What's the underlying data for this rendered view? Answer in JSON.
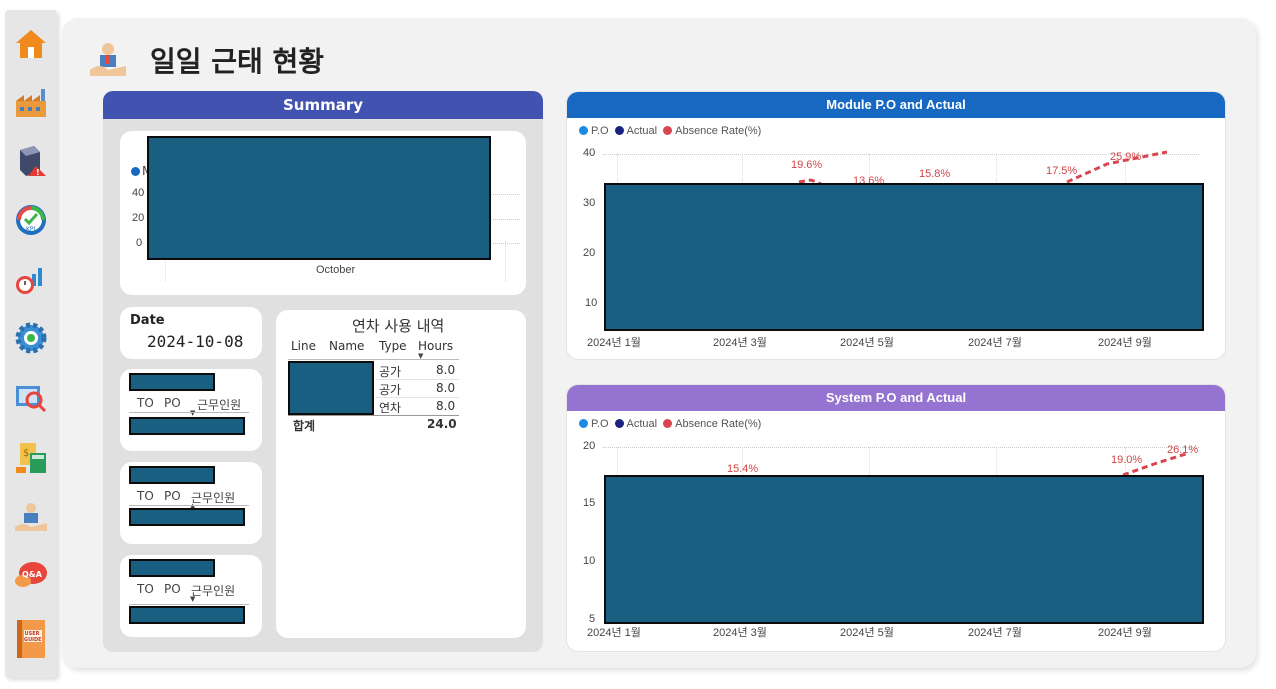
{
  "page": {
    "title": "일일 근태 현황"
  },
  "sidebar": {
    "items": [
      {
        "icon": "home-icon"
      },
      {
        "icon": "factory-icon"
      },
      {
        "icon": "alert-box-icon"
      },
      {
        "icon": "kpi-gauge-icon"
      },
      {
        "icon": "timer-chart-icon"
      },
      {
        "icon": "gear-icon"
      },
      {
        "icon": "map-search-icon"
      },
      {
        "icon": "calculator-icon"
      },
      {
        "icon": "person-hand-icon"
      },
      {
        "icon": "qa-bubble-icon"
      },
      {
        "icon": "user-guide-book-icon"
      }
    ],
    "qa_label": "Q&A",
    "guide_label": "USER GUIDE"
  },
  "summary": {
    "header": "Summary",
    "top_chart": {
      "legend_initial": "M",
      "yticks": [
        "40",
        "20",
        "0"
      ],
      "xlabel": "October"
    },
    "date_label": "Date",
    "date_value": "2024-10-08",
    "columns": [
      "TO",
      "PO",
      "근무인원"
    ]
  },
  "leave_table": {
    "title": "연차 사용 내역",
    "headers": [
      "Line",
      "Name",
      "Type",
      "Hours"
    ],
    "rows": [
      {
        "type": "공가",
        "hours": "8.0"
      },
      {
        "type": "공가",
        "hours": "8.0"
      },
      {
        "type": "연차",
        "hours": "8.0"
      }
    ],
    "total_label": "합계",
    "total_value": "24.0"
  },
  "module_chart": {
    "header": "Module P.O and Actual",
    "header_color": "#1668c0",
    "legend": [
      {
        "label": "P.O",
        "color": "#1e88e5"
      },
      {
        "label": "Actual",
        "color": "#1a237e"
      },
      {
        "label": "Absence Rate(%)",
        "color": "#d8454f"
      }
    ],
    "yticks": [
      "40",
      "30",
      "20",
      "10"
    ],
    "xticks": [
      "2024년 1월",
      "2024년 3월",
      "2024년 5월",
      "2024년 7월",
      "2024년 9월"
    ],
    "rate_labels": [
      "19.6%",
      "13.6%",
      "15.8%",
      "17.5%",
      "25.9%"
    ]
  },
  "system_chart": {
    "header": "System P.O and Actual",
    "header_color": "#9573d1",
    "legend": [
      {
        "label": "P.O",
        "color": "#1e88e5"
      },
      {
        "label": "Actual",
        "color": "#1a237e"
      },
      {
        "label": "Absence Rate(%)",
        "color": "#d8454f"
      }
    ],
    "yticks": [
      "20",
      "15",
      "10",
      "5"
    ],
    "xticks": [
      "2024년 1월",
      "2024년 3월",
      "2024년 5월",
      "2024년 7월",
      "2024년 9월"
    ],
    "rate_labels": [
      "15.4%",
      "19.0%",
      "26.1%"
    ]
  }
}
